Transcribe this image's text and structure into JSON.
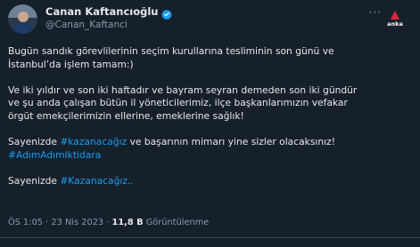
{
  "profile": {
    "name": "Canan Kaftancıoğlu",
    "handle": "@Canan_Kaftanci",
    "verified_icon": "verified-badge-icon"
  },
  "menu": {
    "more_icon": "more-dots-icon"
  },
  "watermark": {
    "text": "anka"
  },
  "tweet": {
    "p1_l1": "Bugün sandık görevlilerinin seçim kurullarına tesliminin son günü ve",
    "p1_l2": "İstanbul’da işlem tamam:)",
    "p2_l1": "Ve iki yıldır ve son iki haftadır ve bayram seyran demeden son iki gündür",
    "p2_l2": "ve şu anda çalışan bütün il yöneticilerimiz, ilçe başkanlarımızın vefakar",
    "p2_l3": "örgüt emekçilerimizin ellerine, emeklerine sağlık!",
    "p3_prefix": "Sayenizde ",
    "p3_hashtag": "#kazanacağız",
    "p3_suffix": " ve başarının mimarı yine sizler olacaksınız!",
    "p3_hashtag2": "#AdımAdımIktidara",
    "p4_prefix": "Sayenizde ",
    "p4_hashtag": "#Kazanacağız..",
    "time": "ÖS 1:05 · 23 Nis 2023 · ",
    "views": "11,8 B",
    "views_label": " Görüntülenme"
  },
  "colors": {
    "background": "#15202b",
    "text": "#e7e9ea",
    "muted": "#8b98a5",
    "link": "#1d9bf0",
    "verified": "#1d9bf0"
  }
}
